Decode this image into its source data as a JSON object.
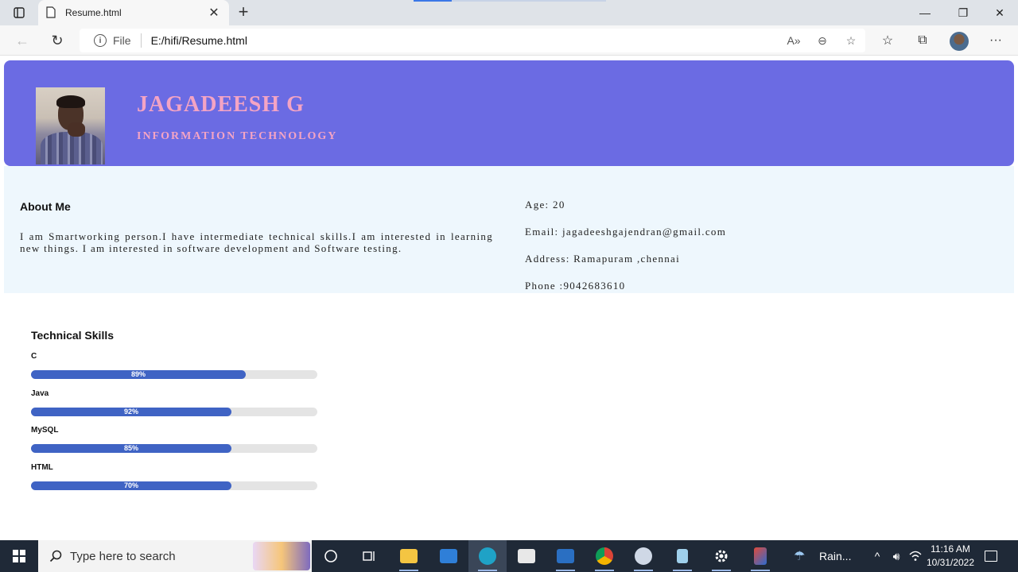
{
  "browser": {
    "tab_title": "Resume.html",
    "tab_close": "✕",
    "new_tab": "+",
    "file_label": "File",
    "url": "E:/hifi/Resume.html",
    "win_minimize": "—",
    "win_restore": "❐",
    "win_close": "✕",
    "back": "←",
    "refresh": "↻",
    "read_aloud": "A»",
    "zoom": "⊖",
    "add_favorite": "☆",
    "favorites": "☆",
    "collections": "⧉",
    "more": "···"
  },
  "resume": {
    "name": "JAGADEESH G",
    "department": "INFORMATION TECHNOLOGY",
    "about_title": "About Me",
    "about_text": "I am Smartworking person.I have intermediate technical skills.I am interested in learning new things. I am interested in software development and Software testing.",
    "age": "Age: 20",
    "email": "Email: jagadeeshgajendran@gmail.com",
    "address": "Address: Ramapuram ,chennai",
    "phone": "Phone :9042683610",
    "skills_title": "Technical Skills",
    "skills": [
      {
        "name": "C",
        "label": "89%",
        "fill": 0.75
      },
      {
        "name": "Java",
        "label": "92%",
        "fill": 0.7
      },
      {
        "name": "MySQL",
        "label": "85%",
        "fill": 0.7
      },
      {
        "name": "HTML",
        "label": "70%",
        "fill": 0.7
      }
    ]
  },
  "taskbar": {
    "search_placeholder": "Type here to search",
    "weather": "Rain...",
    "time": "11:16 AM",
    "date": "10/31/2022",
    "icons": [
      "cortana-icon",
      "task-view-icon",
      "file-explorer-icon",
      "mail-icon",
      "edge-icon",
      "store-icon",
      "photos-icon",
      "chrome-icon",
      "paint-icon",
      "notepad-icon",
      "settings-icon",
      "app-icon"
    ]
  },
  "colors": {
    "header_bg": "#6b6be3",
    "name_color": "#f4a4c4",
    "info_bg": "#eef7fd",
    "skill_fill": "#3f63c4",
    "skill_track": "#e4e4e4"
  }
}
